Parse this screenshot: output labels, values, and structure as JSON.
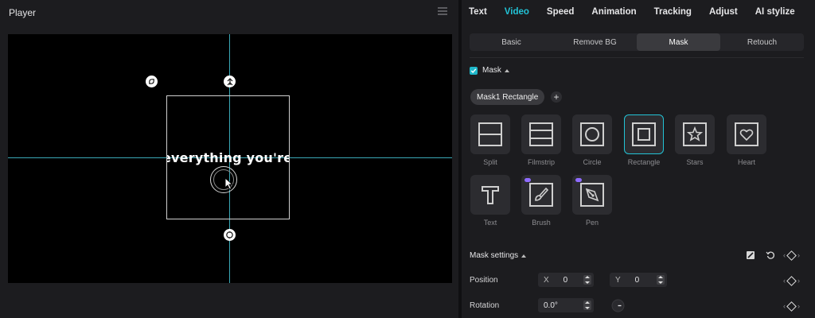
{
  "player": {
    "title": "Player",
    "menu_icon": "hamburger-icon",
    "caption_text": "everything you're doing"
  },
  "inspector": {
    "tabs": [
      {
        "label": "Text",
        "active": false
      },
      {
        "label": "Video",
        "active": true
      },
      {
        "label": "Speed",
        "active": false
      },
      {
        "label": "Animation",
        "active": false
      },
      {
        "label": "Tracking",
        "active": false
      },
      {
        "label": "Adjust",
        "active": false
      },
      {
        "label": "AI stylize",
        "active": false
      }
    ],
    "subtabs": [
      {
        "label": "Basic",
        "active": false
      },
      {
        "label": "Remove BG",
        "active": false
      },
      {
        "label": "Mask",
        "active": true
      },
      {
        "label": "Retouch",
        "active": false
      }
    ],
    "mask_toggle_label": "Mask",
    "mask_checked": true,
    "mask_chip_label": "Mask1 Rectangle",
    "add_label": "+",
    "shapes": [
      {
        "label": "Split",
        "icon": "split-icon",
        "selected": false,
        "pro": false
      },
      {
        "label": "Filmstrip",
        "icon": "filmstrip-icon",
        "selected": false,
        "pro": false
      },
      {
        "label": "Circle",
        "icon": "circle-icon",
        "selected": false,
        "pro": false
      },
      {
        "label": "Rectangle",
        "icon": "rectangle-icon",
        "selected": true,
        "pro": false
      },
      {
        "label": "Stars",
        "icon": "star-icon",
        "selected": false,
        "pro": false
      },
      {
        "label": "Heart",
        "icon": "heart-icon",
        "selected": false,
        "pro": false
      },
      {
        "label": "Text",
        "icon": "text-icon",
        "selected": false,
        "pro": false
      },
      {
        "label": "Brush",
        "icon": "brush-icon",
        "selected": false,
        "pro": true
      },
      {
        "label": "Pen",
        "icon": "pen-icon",
        "selected": false,
        "pro": true
      }
    ],
    "mask_settings_label": "Mask settings",
    "position_label": "Position",
    "x_label": "X",
    "x_value": "0",
    "y_label": "Y",
    "y_value": "0",
    "rotation_label": "Rotation",
    "rotation_value": "0.0°",
    "accent_color": "#22c3d6"
  }
}
